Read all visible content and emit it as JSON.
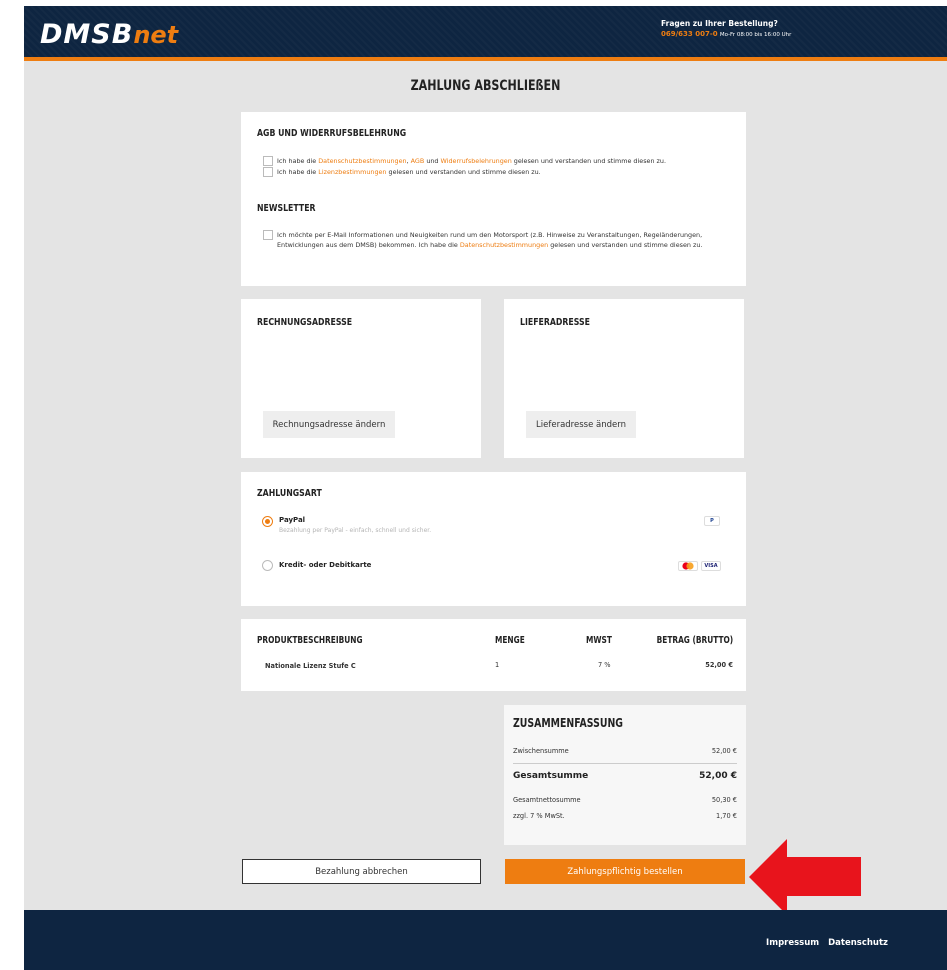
{
  "header": {
    "logo_main": "DMSB",
    "logo_accent": "net",
    "help_question": "Fragen zu Ihrer Bestellung?",
    "help_phone": "069/633 007-0",
    "help_hours": "Mo-Fr 08:00 bis 16:00 Uhr"
  },
  "page": {
    "title": "ZAHLUNG ABSCHLIEßEN"
  },
  "agb": {
    "heading": "AGB UND WIDERRUFSBELEHRUNG",
    "line1_pre": "Ich habe die ",
    "line1_link1": "Datenschutzbestimmungen",
    "line1_mid1": ", ",
    "line1_link2": "AGB",
    "line1_mid2": " und ",
    "line1_link3": "Widerrufsbelehrungen",
    "line1_post": " gelesen und verstanden und stimme diesen zu.",
    "line2_pre": "Ich habe die ",
    "line2_link": "Lizenzbestimmungen",
    "line2_post": " gelesen und verstanden und stimme diesen zu."
  },
  "newsletter": {
    "heading": "NEWSLETTER",
    "text_pre": "Ich möchte per E-Mail Informationen und Neuigkeiten rund um den Motorsport (z.B. Hinweise zu Veranstaltungen, Regeländerungen, Entwicklungen aus dem DMSB) bekommen. Ich habe die ",
    "text_link": "Datenschutzbestimmungen",
    "text_post": " gelesen und verstanden und stimme diesen zu."
  },
  "billing": {
    "heading": "RECHNUNGSADRESSE",
    "button": "Rechnungsadresse ändern"
  },
  "shipping": {
    "heading": "LIEFERADRESSE",
    "button": "Lieferadresse ändern"
  },
  "payment": {
    "heading": "ZAHLUNGSART",
    "paypal_label": "PayPal",
    "paypal_desc": "Bezahlung per PayPal - einfach, schnell und sicher.",
    "card_label": "Kredit- oder Debitkarte",
    "paypal_badge": "P",
    "visa_badge": "VISA"
  },
  "products": {
    "headers": [
      "PRODUKTBESCHREIBUNG",
      "MENGE",
      "MWST",
      "BETRAG (BRUTTO)"
    ],
    "row": {
      "name": "Nationale Lizenz Stufe C",
      "qty": "1",
      "vat": "7 %",
      "amount": "52,00 €"
    }
  },
  "summary": {
    "heading": "ZUSAMMENFASSUNG",
    "subtotal_label": "Zwischensumme",
    "subtotal_value": "52,00 €",
    "total_label": "Gesamtsumme",
    "total_value": "52,00 €",
    "net_label": "Gesamtnettosumme",
    "net_value": "50,30 €",
    "vat_label": "zzgl. 7 % MwSt.",
    "vat_value": "1,70 €"
  },
  "actions": {
    "cancel": "Bezahlung abbrechen",
    "order": "Zahlungspflichtig bestellen"
  },
  "footer": {
    "impressum": "Impressum",
    "datenschutz": "Datenschutz"
  },
  "colors": {
    "accent": "#ee7d11",
    "navy": "#0e2541",
    "arrow": "#e8141c"
  }
}
